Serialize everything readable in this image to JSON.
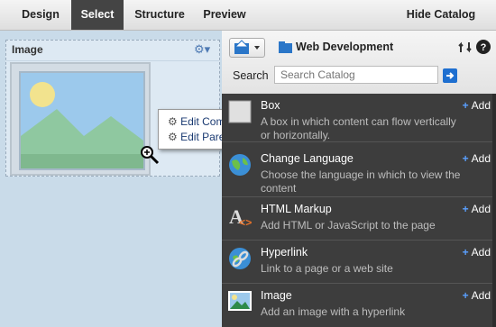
{
  "tabs": [
    {
      "label": "Design"
    },
    {
      "label": "Select"
    },
    {
      "label": "Structure"
    },
    {
      "label": "Preview"
    }
  ],
  "hide_catalog": "Hide Catalog",
  "component": {
    "title": "Image",
    "gear_icon": "gear-icon"
  },
  "context_menu": {
    "items": [
      "Edit Component",
      "Edit Parent Component"
    ]
  },
  "catalog": {
    "name": "Web Development",
    "search_label": "Search",
    "search_placeholder": "Search Catalog",
    "add_label": "Add",
    "items": [
      {
        "title": "Box",
        "desc": "A box in which content can flow vertically or horizontally.",
        "icon": "box-icon"
      },
      {
        "title": "Change Language",
        "desc": "Choose the language in which to view the content",
        "icon": "globe-icon"
      },
      {
        "title": "HTML Markup",
        "desc": "Add HTML or JavaScript to the page",
        "icon": "html-icon"
      },
      {
        "title": "Hyperlink",
        "desc": "Link to a page or a web site",
        "icon": "hyperlink-icon"
      },
      {
        "title": "Image",
        "desc": "Add an image with a hyperlink",
        "icon": "image-icon"
      }
    ]
  }
}
